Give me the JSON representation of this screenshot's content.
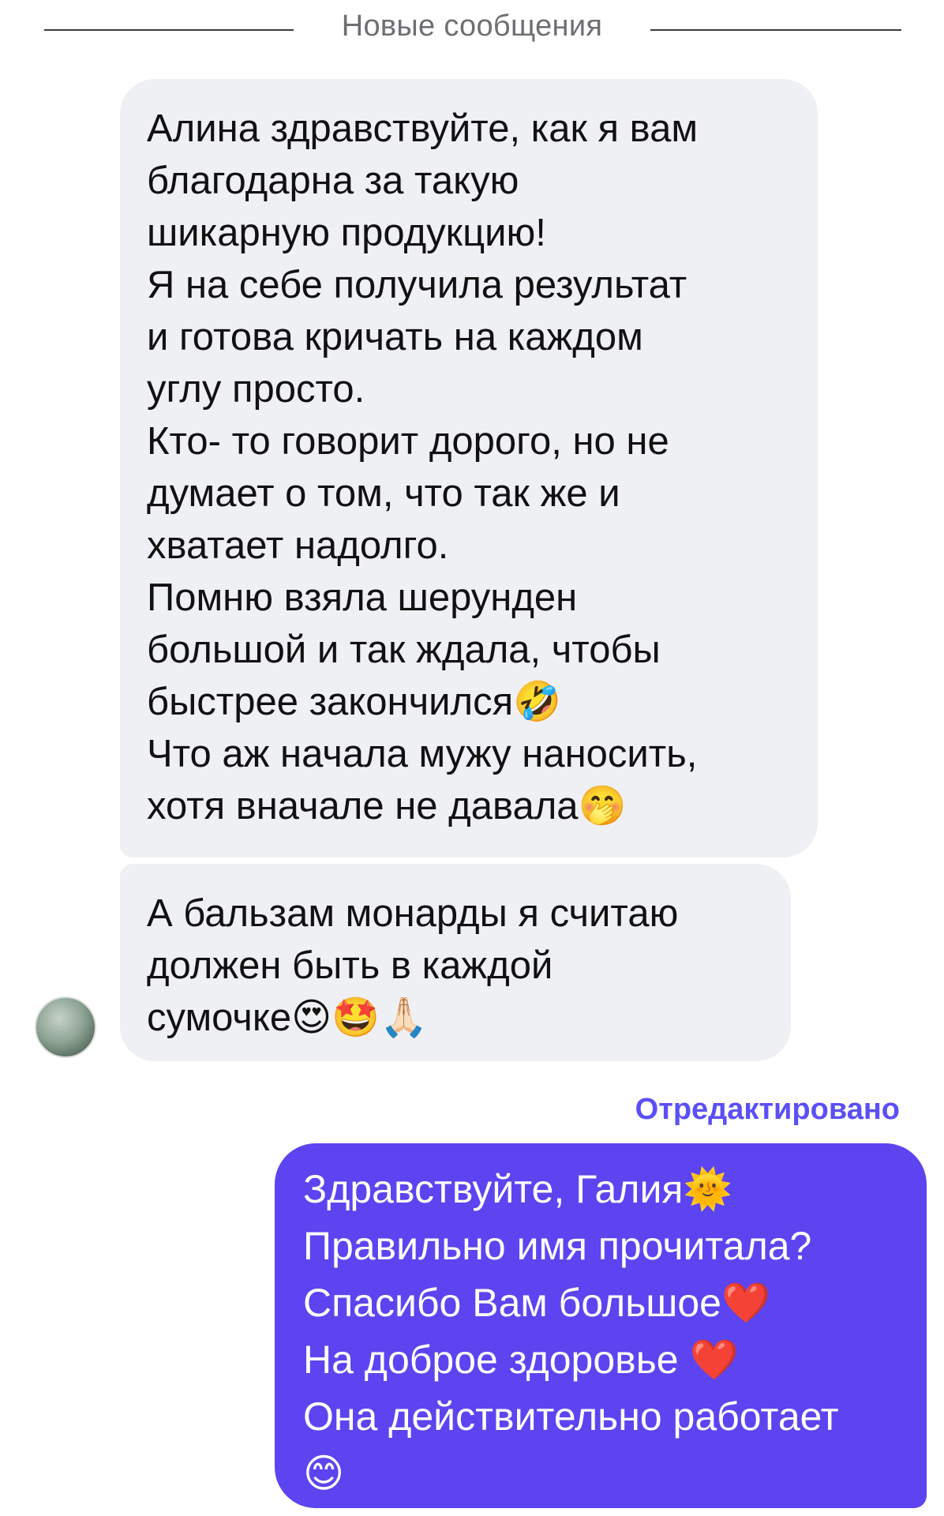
{
  "divider": {
    "label": "Новые сообщения"
  },
  "incoming": {
    "message1": {
      "lines": [
        "Алина здравствуйте, как я вам",
        "благодарна за такую",
        "шикарную продукцию!",
        "Я на себе получила результат",
        "и готова кричать на каждом",
        "углу просто.",
        "Кто- то говорит дорого, но не",
        "думает о том, что так же и",
        "хватает надолго.",
        "Помню взяла шерунден",
        "большой и так ждала, чтобы",
        "быстрее закончился🤣",
        "Что аж начала мужу наносить,",
        "хотя вначале не давала🤭"
      ]
    },
    "message2": {
      "lines": [
        "А бальзам монарды я считаю",
        "должен быть в каждой",
        "сумочке😍🤩🙏🏻"
      ]
    }
  },
  "outgoing": {
    "edited_label": "Отредактировано",
    "message": {
      "lines": [
        "Здравствуйте, Галия🌞",
        "Правильно имя прочитала?",
        "Спасибо Вам большое❤️",
        "На доброе здоровье ❤️",
        "Она действительно работает",
        "😊"
      ]
    }
  },
  "colors": {
    "incoming_bubble": "#eff0f3",
    "outgoing_bubble": "#5c44f0",
    "edited_label": "#5b4ff5"
  }
}
